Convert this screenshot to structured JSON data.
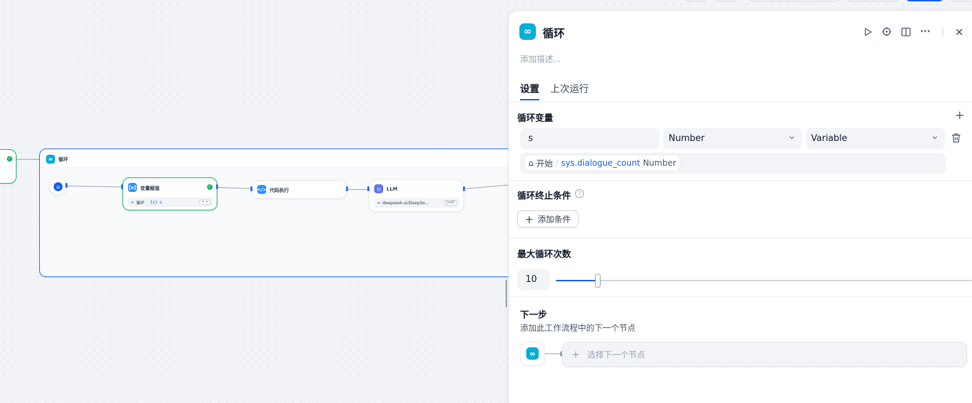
{
  "colors": {
    "accent": "#155eef",
    "loop_icon": "#06aed4",
    "assign_icon": "#2e90fa",
    "code_icon": "#2e90fa",
    "llm_icon": "#6172f3",
    "success": "#17b26a"
  },
  "canvas": {
    "loop_node": {
      "title": "循环",
      "icon": "loop-icon"
    },
    "start_node": {
      "icon": "home-icon"
    },
    "assign_node": {
      "title": "变量赋值",
      "icon": "variable-assign-icon",
      "row_loop": "循环",
      "row_var": "s",
      "row_tag": "= ="
    },
    "code_node": {
      "title": "代码执行",
      "icon": "code-icon"
    },
    "llm_node": {
      "title": "LLM",
      "model": "deepseek-ai/DeepSe...",
      "mode": "CHAT"
    }
  },
  "panel": {
    "title": "循环",
    "description_placeholder": "添加描述...",
    "header_actions": [
      "run-icon",
      "locate-icon",
      "split-view-icon",
      "more-icon",
      "close-icon"
    ],
    "tabs": [
      {
        "label": "设置",
        "active": true
      },
      {
        "label": "上次运行",
        "active": false
      }
    ],
    "loop_variables": {
      "title": "循环变量",
      "add_icon": "plus-icon",
      "items": [
        {
          "name": "s",
          "type": "Number",
          "source": "Variable",
          "ref_node": "开始",
          "ref_separator": "/",
          "ref_var": "sys.dialogue_count",
          "ref_type": "Number"
        }
      ]
    },
    "break_condition": {
      "title": "循环终止条件",
      "help_icon": "question-icon",
      "add_label": "添加条件"
    },
    "max_loops": {
      "title": "最大循环次数",
      "value": "10",
      "slider_fraction": 0.1
    },
    "next_step": {
      "title": "下一步",
      "description": "添加此工作流程中的下一个节点",
      "select_label": "选择下一个节点"
    }
  }
}
